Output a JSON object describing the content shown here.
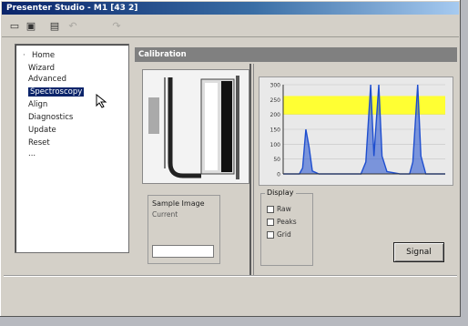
{
  "window": {
    "title": "Presenter Studio - M1 [43 2]"
  },
  "toolbar": {
    "icons": [
      "open-folder-icon",
      "save-icon",
      "print-icon",
      "undo-icon",
      "redo-icon"
    ]
  },
  "tree": {
    "items": [
      {
        "label": "Home"
      },
      {
        "label": "Wizard"
      },
      {
        "label": "Advanced"
      },
      {
        "label": "Spectroscopy",
        "selected": true
      },
      {
        "label": "Align"
      },
      {
        "label": "Diagnostics"
      },
      {
        "label": "Update"
      },
      {
        "label": "Reset"
      },
      {
        "label": "..."
      }
    ]
  },
  "panel": {
    "header": "Calibration"
  },
  "scan_image_area": {
    "label": "Sample Image",
    "sub": "Current"
  },
  "display_group": {
    "title": "Display",
    "options": [
      "Raw",
      "Peaks",
      "Grid"
    ]
  },
  "buttons": {
    "signal": "Signal"
  },
  "chart_data": {
    "type": "line",
    "title": "",
    "xlabel": "",
    "ylabel": "",
    "yticks": [
      "300",
      "250",
      "200",
      "150",
      "100",
      "50",
      "0"
    ],
    "ylim": [
      0,
      300
    ],
    "xlim": [
      0,
      100
    ],
    "band": {
      "ymin": 200,
      "ymax": 262,
      "color": "#ffff33"
    },
    "series": [
      {
        "color": "#1f4fcf",
        "points": [
          [
            0,
            0
          ],
          [
            10,
            0
          ],
          [
            12,
            20
          ],
          [
            14,
            150
          ],
          [
            16,
            90
          ],
          [
            18,
            10
          ],
          [
            22,
            0
          ],
          [
            48,
            0
          ],
          [
            51,
            40
          ],
          [
            54,
            300
          ],
          [
            56,
            60
          ],
          [
            59,
            300
          ],
          [
            61,
            60
          ],
          [
            64,
            8
          ],
          [
            72,
            0
          ],
          [
            78,
            0
          ],
          [
            80,
            40
          ],
          [
            83,
            300
          ],
          [
            85,
            60
          ],
          [
            88,
            0
          ],
          [
            100,
            0
          ]
        ]
      }
    ],
    "grid": true
  }
}
